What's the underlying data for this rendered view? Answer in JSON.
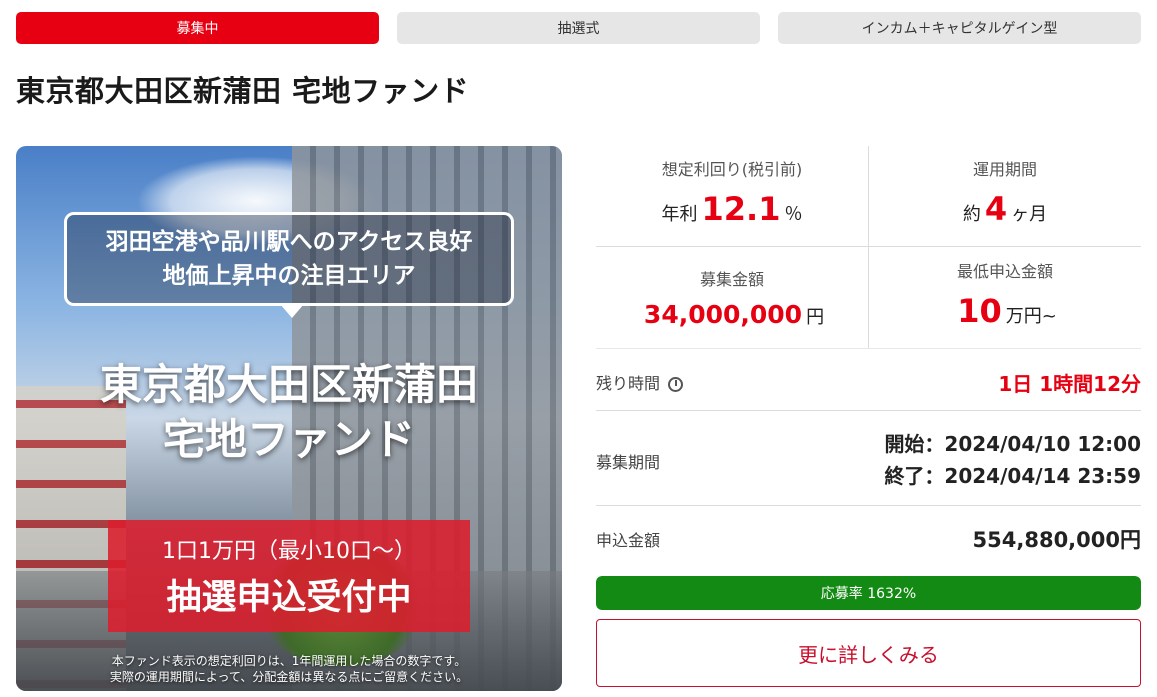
{
  "badges": [
    "募集中",
    "抽選式",
    "インカム＋キャピタルゲイン型"
  ],
  "title": "東京都大田区新蒲田 宅地ファンド",
  "hero": {
    "bubble_line1": "羽田空港や品川駅へのアクセス良好",
    "bubble_line2": "地価上昇中の注目エリア",
    "title_line1": "東京都大田区新蒲田",
    "title_line2": "宅地ファンド",
    "box_line1": "1口1万円（最小10口～）",
    "box_line2": "抽選申込受付中",
    "note_line1": "本ファンド表示の想定利回りは、1年間運用した場合の数字です。",
    "note_line2": "実際の運用期間によって、分配金額は異なる点にご留意ください。"
  },
  "stats": {
    "yield": {
      "label": "想定利回り(税引前)",
      "prefix": "年利",
      "value": "12.1",
      "unit": "％"
    },
    "period": {
      "label": "運用期間",
      "prefix": "約",
      "value": "4",
      "unit": "ヶ月"
    },
    "amount": {
      "label": "募集金額",
      "value": "34,000,000",
      "unit": "円"
    },
    "min": {
      "label": "最低申込金額",
      "value": "10",
      "unit": "万円~"
    }
  },
  "remaining": {
    "label": "残り時間",
    "value": "1日 1時間12分"
  },
  "recruit_period": {
    "label": "募集期間",
    "start": "開始：2024/04/10 12:00",
    "end": "終了：2024/04/14 23:59"
  },
  "application": {
    "label": "申込金額",
    "value": "554,880,000円"
  },
  "progress": {
    "text": "応募率 1632%",
    "fill_percent": 100
  },
  "detail_button": "更に詳しくみる",
  "colors": {
    "accent": "#e60012",
    "progress": "#138a13"
  }
}
